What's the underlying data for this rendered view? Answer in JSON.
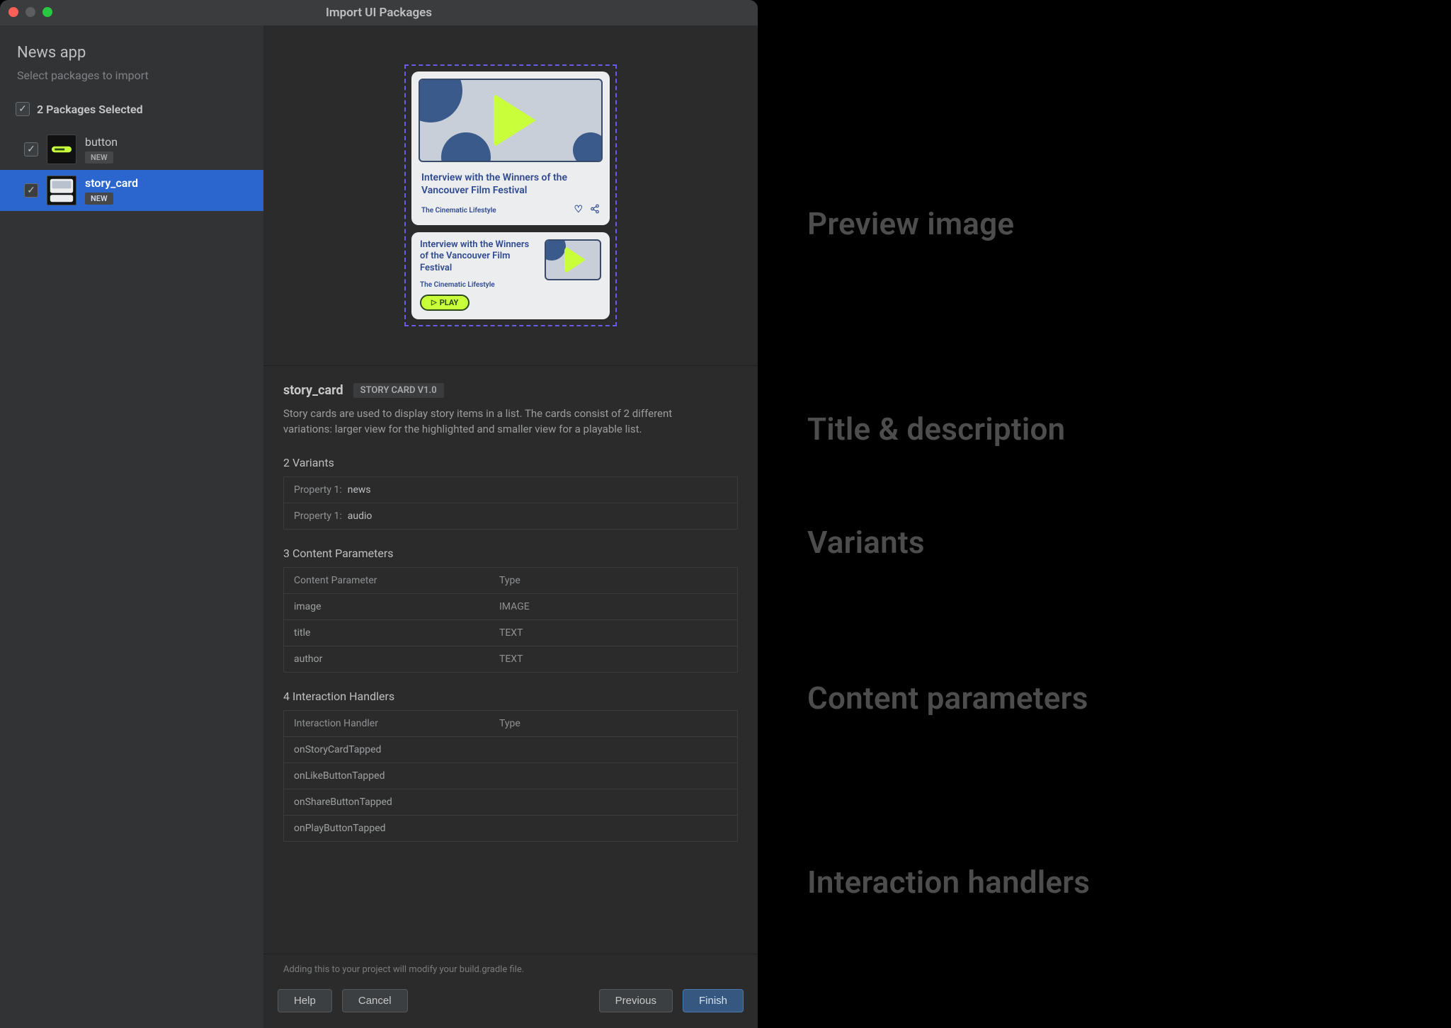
{
  "titlebar": {
    "title": "Import UI Packages"
  },
  "sidebar": {
    "title": "News app",
    "subtitle": "Select packages to import",
    "summary": "2 Packages Selected",
    "items": [
      {
        "name": "button",
        "badge": "NEW",
        "selected": false
      },
      {
        "name": "story_card",
        "badge": "NEW",
        "selected": true
      }
    ]
  },
  "preview": {
    "card_large": {
      "title": "Interview with the Winners of the Vancouver Film Festival",
      "author": "The Cinematic Lifestyle"
    },
    "card_small": {
      "title": "Interview with the Winners of the Vancouver Film Festival",
      "author": "The Cinematic Lifestyle",
      "play_label": "PLAY"
    }
  },
  "details": {
    "name": "story_card",
    "version": "STORY CARD V1.0",
    "description": "Story cards are used to display story items in a list. The cards consist of 2 different variations: larger view for the highlighted and smaller view for a playable list.",
    "variants": {
      "heading": "2 Variants",
      "rows": [
        {
          "label": "Property 1:",
          "value": "news"
        },
        {
          "label": "Property 1:",
          "value": "audio"
        }
      ]
    },
    "content_params": {
      "heading": "3 Content Parameters",
      "header": {
        "col1": "Content Parameter",
        "col2": "Type"
      },
      "rows": [
        {
          "name": "image",
          "type": "IMAGE"
        },
        {
          "name": "title",
          "type": "TEXT"
        },
        {
          "name": "author",
          "type": "TEXT"
        }
      ]
    },
    "handlers": {
      "heading": "4 Interaction Handlers",
      "header": {
        "col1": "Interaction Handler",
        "col2": "Type"
      },
      "rows": [
        {
          "name": "onStoryCardTapped"
        },
        {
          "name": "onLikeButtonTapped"
        },
        {
          "name": "onShareButtonTapped"
        },
        {
          "name": "onPlayButtonTapped"
        }
      ]
    }
  },
  "footer": {
    "note": "Adding this to your project will modify your build.gradle file.",
    "help": "Help",
    "cancel": "Cancel",
    "previous": "Previous",
    "finish": "Finish"
  },
  "annotations": {
    "preview": "Preview image",
    "title_desc": "Title & description",
    "variants": "Variants",
    "content_params": "Content parameters",
    "handlers": "Interaction handlers"
  }
}
